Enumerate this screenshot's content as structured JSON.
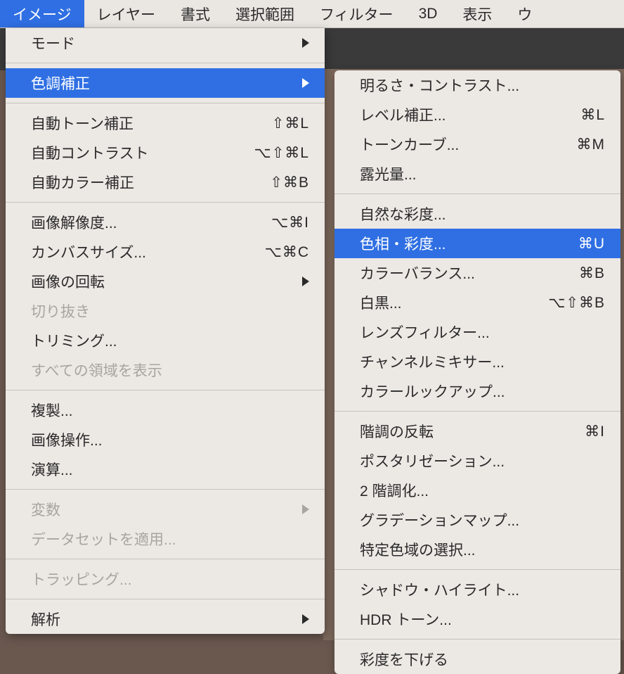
{
  "menubar": [
    {
      "label": "イメージ",
      "active": true
    },
    {
      "label": "レイヤー"
    },
    {
      "label": "書式"
    },
    {
      "label": "選択範囲"
    },
    {
      "label": "フィルター"
    },
    {
      "label": "3D"
    },
    {
      "label": "表示"
    },
    {
      "label": "ウ"
    }
  ],
  "primaryMenu": [
    {
      "label": "モード",
      "submenu": true
    },
    {
      "sep": true
    },
    {
      "label": "色調補正",
      "submenu": true,
      "highlight": true
    },
    {
      "sep": true
    },
    {
      "label": "自動トーン補正",
      "shortcut": "⇧⌘L"
    },
    {
      "label": "自動コントラスト",
      "shortcut": "⌥⇧⌘L"
    },
    {
      "label": "自動カラー補正",
      "shortcut": "⇧⌘B"
    },
    {
      "sep": true
    },
    {
      "label": "画像解像度...",
      "shortcut": "⌥⌘I"
    },
    {
      "label": "カンバスサイズ...",
      "shortcut": "⌥⌘C"
    },
    {
      "label": "画像の回転",
      "submenu": true
    },
    {
      "label": "切り抜き",
      "disabled": true
    },
    {
      "label": "トリミング..."
    },
    {
      "label": "すべての領域を表示",
      "disabled": true
    },
    {
      "sep": true
    },
    {
      "label": "複製..."
    },
    {
      "label": "画像操作..."
    },
    {
      "label": "演算..."
    },
    {
      "sep": true
    },
    {
      "label": "変数",
      "submenu": true,
      "disabled": true
    },
    {
      "label": "データセットを適用...",
      "disabled": true
    },
    {
      "sep": true
    },
    {
      "label": "トラッピング...",
      "disabled": true
    },
    {
      "sep": true
    },
    {
      "label": "解析",
      "submenu": true
    }
  ],
  "secondaryMenu": [
    {
      "label": "明るさ・コントラスト..."
    },
    {
      "label": "レベル補正...",
      "shortcut": "⌘L"
    },
    {
      "label": "トーンカーブ...",
      "shortcut": "⌘M"
    },
    {
      "label": "露光量..."
    },
    {
      "sep": true
    },
    {
      "label": "自然な彩度..."
    },
    {
      "label": "色相・彩度...",
      "shortcut": "⌘U",
      "highlight": true
    },
    {
      "label": "カラーバランス...",
      "shortcut": "⌘B"
    },
    {
      "label": "白黒...",
      "shortcut": "⌥⇧⌘B"
    },
    {
      "label": "レンズフィルター..."
    },
    {
      "label": "チャンネルミキサー..."
    },
    {
      "label": "カラールックアップ..."
    },
    {
      "sep": true
    },
    {
      "label": "階調の反転",
      "shortcut": "⌘I"
    },
    {
      "label": "ポスタリゼーション..."
    },
    {
      "label": "2 階調化..."
    },
    {
      "label": "グラデーションマップ..."
    },
    {
      "label": "特定色域の選択..."
    },
    {
      "sep": true
    },
    {
      "label": "シャドウ・ハイライト..."
    },
    {
      "label": "HDR トーン..."
    },
    {
      "sep": true
    },
    {
      "label": "彩度を下げる"
    }
  ]
}
